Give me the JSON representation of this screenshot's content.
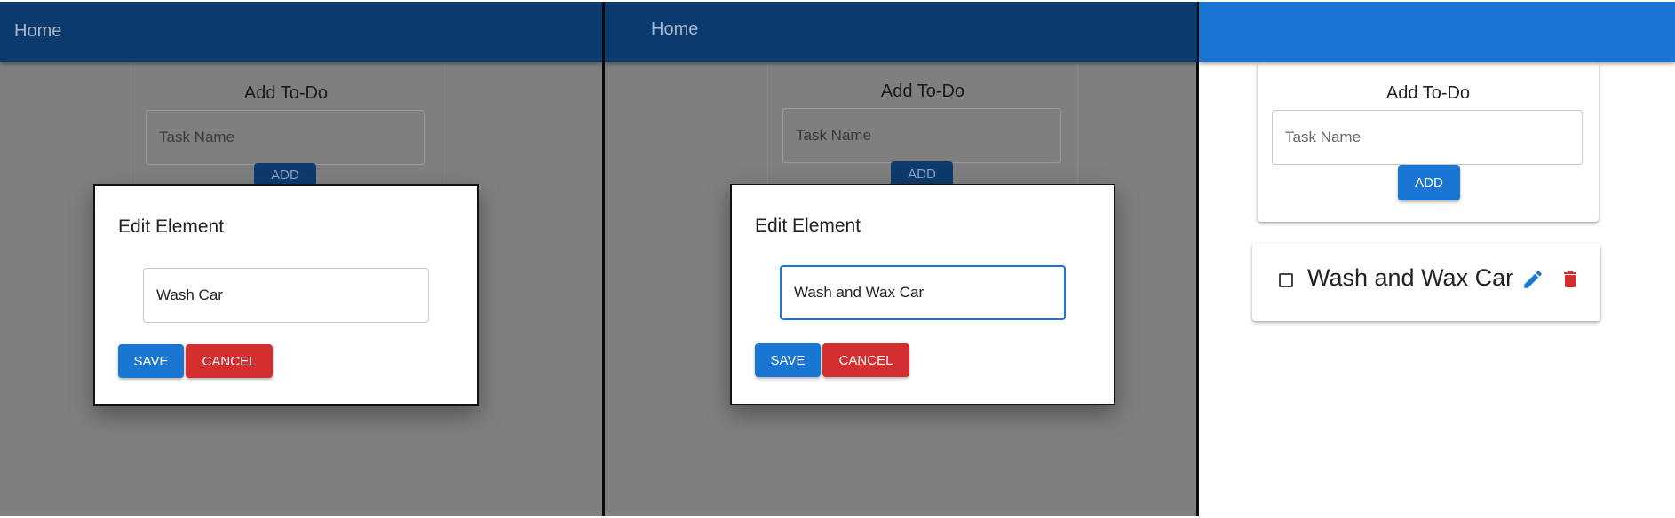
{
  "panels": [
    {
      "appbar": {
        "home_label": "Home"
      },
      "add_card": {
        "title": "Add To-Do",
        "input_placeholder": "Task Name",
        "add_label": "ADD"
      },
      "dialog": {
        "title": "Edit Element",
        "input_value": "Wash Car",
        "save_label": "SAVE",
        "cancel_label": "CANCEL"
      }
    },
    {
      "appbar": {
        "home_label": "Home"
      },
      "add_card": {
        "title": "Add To-Do",
        "input_placeholder": "Task Name",
        "add_label": "ADD"
      },
      "dialog": {
        "title": "Edit Element",
        "input_value": "Wash and Wax Car",
        "save_label": "SAVE",
        "cancel_label": "CANCEL"
      }
    },
    {
      "add_card": {
        "title": "Add To-Do",
        "input_placeholder": "Task Name",
        "add_label": "ADD"
      },
      "todo_items": [
        {
          "text": "Wash and Wax Car",
          "checked": false,
          "edit_icon": "pencil-icon",
          "delete_icon": "trash-icon"
        }
      ]
    }
  ],
  "colors": {
    "primary": "#1976d2",
    "primary_dimmed": "#0b3a6e",
    "danger": "#d32f2f",
    "backdrop": "#7f7f7f"
  }
}
